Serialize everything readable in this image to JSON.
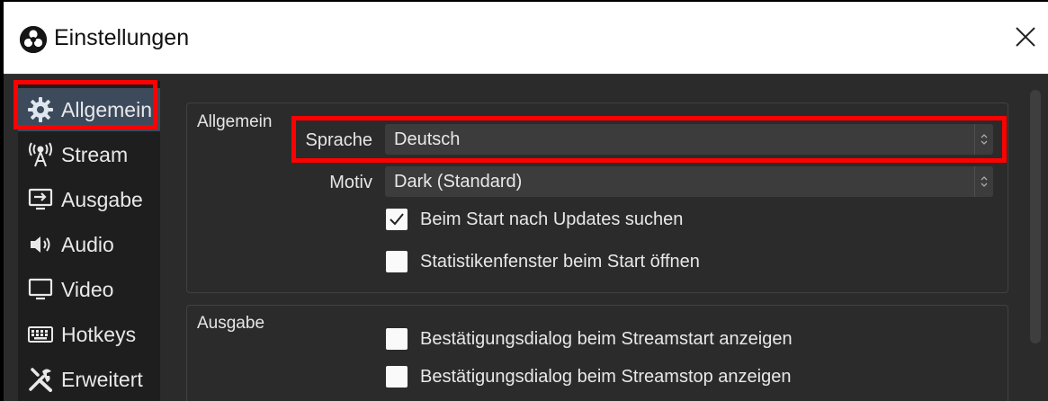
{
  "window": {
    "title": "Einstellungen"
  },
  "sidebar": {
    "items": [
      {
        "label": "Allgemein",
        "icon": "gear-icon",
        "active": true
      },
      {
        "label": "Stream",
        "icon": "antenna-icon"
      },
      {
        "label": "Ausgabe",
        "icon": "output-icon"
      },
      {
        "label": "Audio",
        "icon": "speaker-icon"
      },
      {
        "label": "Video",
        "icon": "monitor-icon"
      },
      {
        "label": "Hotkeys",
        "icon": "keyboard-icon"
      },
      {
        "label": "Erweitert",
        "icon": "tools-icon"
      }
    ]
  },
  "general": {
    "title": "Allgemein",
    "language_label": "Sprache",
    "language_value": "Deutsch",
    "theme_label": "Motiv",
    "theme_value": "Dark (Standard)",
    "check_updates": {
      "label": "Beim Start nach Updates suchen",
      "checked": true
    },
    "stats_window": {
      "label": "Statistikenfenster beim Start öffnen",
      "checked": false
    }
  },
  "output": {
    "title": "Ausgabe",
    "confirm_start": {
      "label": "Bestätigungsdialog beim Streamstart anzeigen",
      "checked": false
    },
    "confirm_stop": {
      "label": "Bestätigungsdialog beim Streamstop anzeigen",
      "checked": false
    }
  },
  "colors": {
    "highlight": "#ff0000",
    "active_nav": "#3c4a5c",
    "panel": "#2b2b2b"
  }
}
